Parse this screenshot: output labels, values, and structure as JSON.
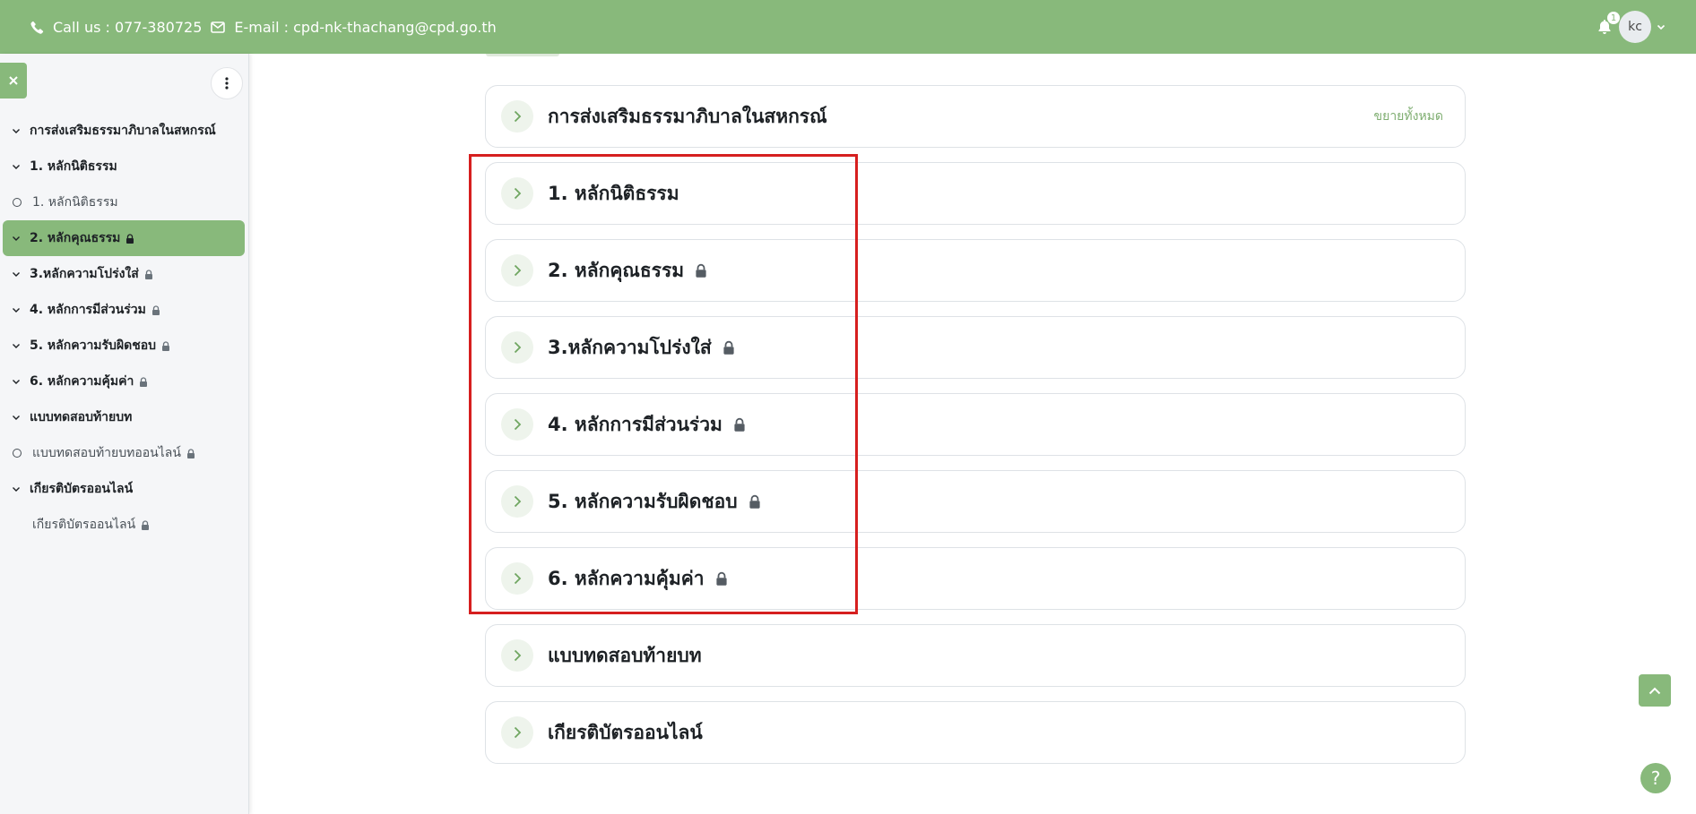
{
  "header": {
    "phone": "Call us : 077-380725",
    "email": "E-mail : cpd-nk-thachang@cpd.go.th",
    "notification_count": "1",
    "user_initials": "kc"
  },
  "drawer": {
    "items": [
      {
        "label": "การส่งเสริมธรรมาภิบาลในสหกรณ์"
      },
      {
        "label": "1. หลักนิติธรรม"
      },
      {
        "label": "1. หลักนิติธรรม"
      },
      {
        "label": "2. หลักคุณธรรม"
      },
      {
        "label": "3.หลักความโปร่งใส่"
      },
      {
        "label": "4. หลักการมีส่วนร่วม"
      },
      {
        "label": "5. หลักความรับผิดชอบ"
      },
      {
        "label": "6. หลักความคุ้มค่า"
      },
      {
        "label": "แบบทดสอบท้ายบท"
      },
      {
        "label": "แบบทดสอบท้ายบทออนไลน์"
      },
      {
        "label": "เกียรติบัตรออนไลน์"
      },
      {
        "label": "เกียรติบัตรออนไลน์"
      }
    ]
  },
  "main": {
    "expand_all": "ขยายทั้งหมด",
    "sections": [
      {
        "title": "การส่งเสริมธรรมาภิบาลในสหกรณ์"
      },
      {
        "title": "1. หลักนิติธรรม"
      },
      {
        "title": "2. หลักคุณธรรม"
      },
      {
        "title": "3.หลักความโปร่งใส่"
      },
      {
        "title": "4. หลักการมีส่วนร่วม"
      },
      {
        "title": "5. หลักความรับผิดชอบ"
      },
      {
        "title": "6. หลักความคุ้มค่า"
      },
      {
        "title": "แบบทดสอบท้ายบท"
      },
      {
        "title": "เกียรติบัตรออนไลน์"
      }
    ]
  },
  "help_label": "?",
  "colors": {
    "brand": "#88b97b",
    "highlight": "#d61f1f"
  }
}
